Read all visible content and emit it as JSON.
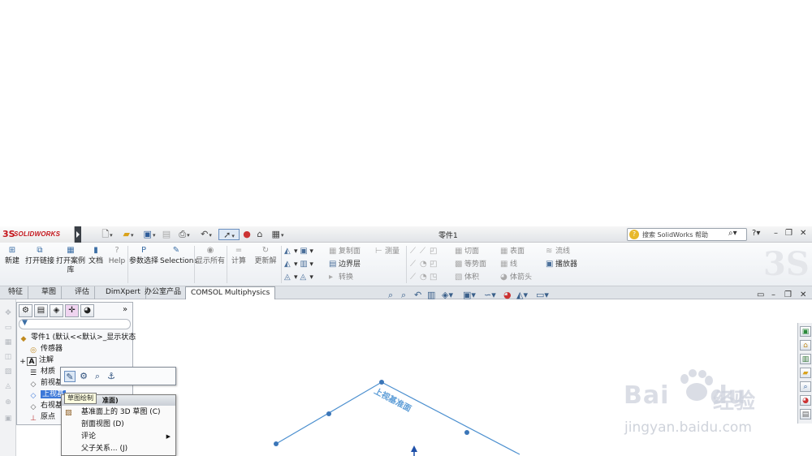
{
  "app": {
    "brand": "SOLIDWORKS",
    "brand_prefix": "3S",
    "document_title": "零件1",
    "help_search_placeholder": "搜索 SolidWorks 帮助",
    "help_button": "?"
  },
  "colors": {
    "accent": "#3c78d8",
    "brand_red": "#c4161c",
    "sketch_blue": "#4b8fcf"
  },
  "command_manager": {
    "big_buttons": [
      {
        "label": "新建",
        "icon": "new-icon"
      },
      {
        "label": "打开链接",
        "icon": "open-link-icon"
      },
      {
        "label": "打开案例库",
        "icon": "example-library-icon"
      },
      {
        "label": "文档",
        "icon": "document-icon"
      },
      {
        "label": "Help",
        "icon": "help-icon"
      },
      {
        "label": "参数选择",
        "icon": "parameter-select-icon"
      },
      {
        "label": "Selections",
        "icon": "selections-icon"
      },
      {
        "label": "显示所有",
        "icon": "show-all-icon"
      },
      {
        "label": "计算",
        "icon": "compute-icon"
      },
      {
        "label": "更新解",
        "icon": "update-solution-icon"
      }
    ],
    "small_buttons": {
      "copy_face": "复制面",
      "measure": "测量",
      "boundary_layer": "边界层",
      "convert": "转换",
      "cut_plane": "切面",
      "surface": "表面",
      "streamline": "流线",
      "isosurface": "等势面",
      "line": "线",
      "player": "播放器",
      "volume": "体积",
      "volume_arrow": "体箭头"
    }
  },
  "tabs": [
    {
      "label": "特征",
      "active": false
    },
    {
      "label": "草图",
      "active": false
    },
    {
      "label": "评估",
      "active": false
    },
    {
      "label": "DimXpert",
      "active": false
    },
    {
      "label": "办公室产品",
      "active": false
    },
    {
      "label": "COMSOL Multiphysics",
      "active": true
    }
  ],
  "feature_tree": {
    "root": "零件1 (默认<<默认>_显示状态",
    "items": [
      {
        "label": "传感器",
        "icon": "sensor-icon",
        "expander": ""
      },
      {
        "label": "注解",
        "icon": "annotation-icon",
        "expander": "+"
      },
      {
        "label": "材质",
        "icon": "material-icon",
        "expander": ""
      },
      {
        "label": "前视基",
        "icon": "plane-icon",
        "expander": ""
      },
      {
        "label": "上视基",
        "icon": "plane-icon",
        "expander": "",
        "selected": true
      },
      {
        "label": "右视基",
        "icon": "plane-icon",
        "expander": ""
      },
      {
        "label": "原点",
        "icon": "origin-icon",
        "expander": ""
      }
    ]
  },
  "context_menu": {
    "tooltip": "草图绘制",
    "header": "准面)",
    "items": [
      {
        "label": "基准面上的 3D 草图 (C)",
        "has_submenu": false
      },
      {
        "label": "剖面视图 (D)",
        "has_submenu": false
      },
      {
        "label": "评论",
        "has_submenu": true
      },
      {
        "label": "父子关系... (J)",
        "has_submenu": false
      }
    ]
  },
  "viewport": {
    "plane_label": "上视基准面"
  },
  "watermark": {
    "brand": "Bai",
    "brand_tail": "du",
    "cn": "经验",
    "url": "jingyan.baidu.com"
  }
}
